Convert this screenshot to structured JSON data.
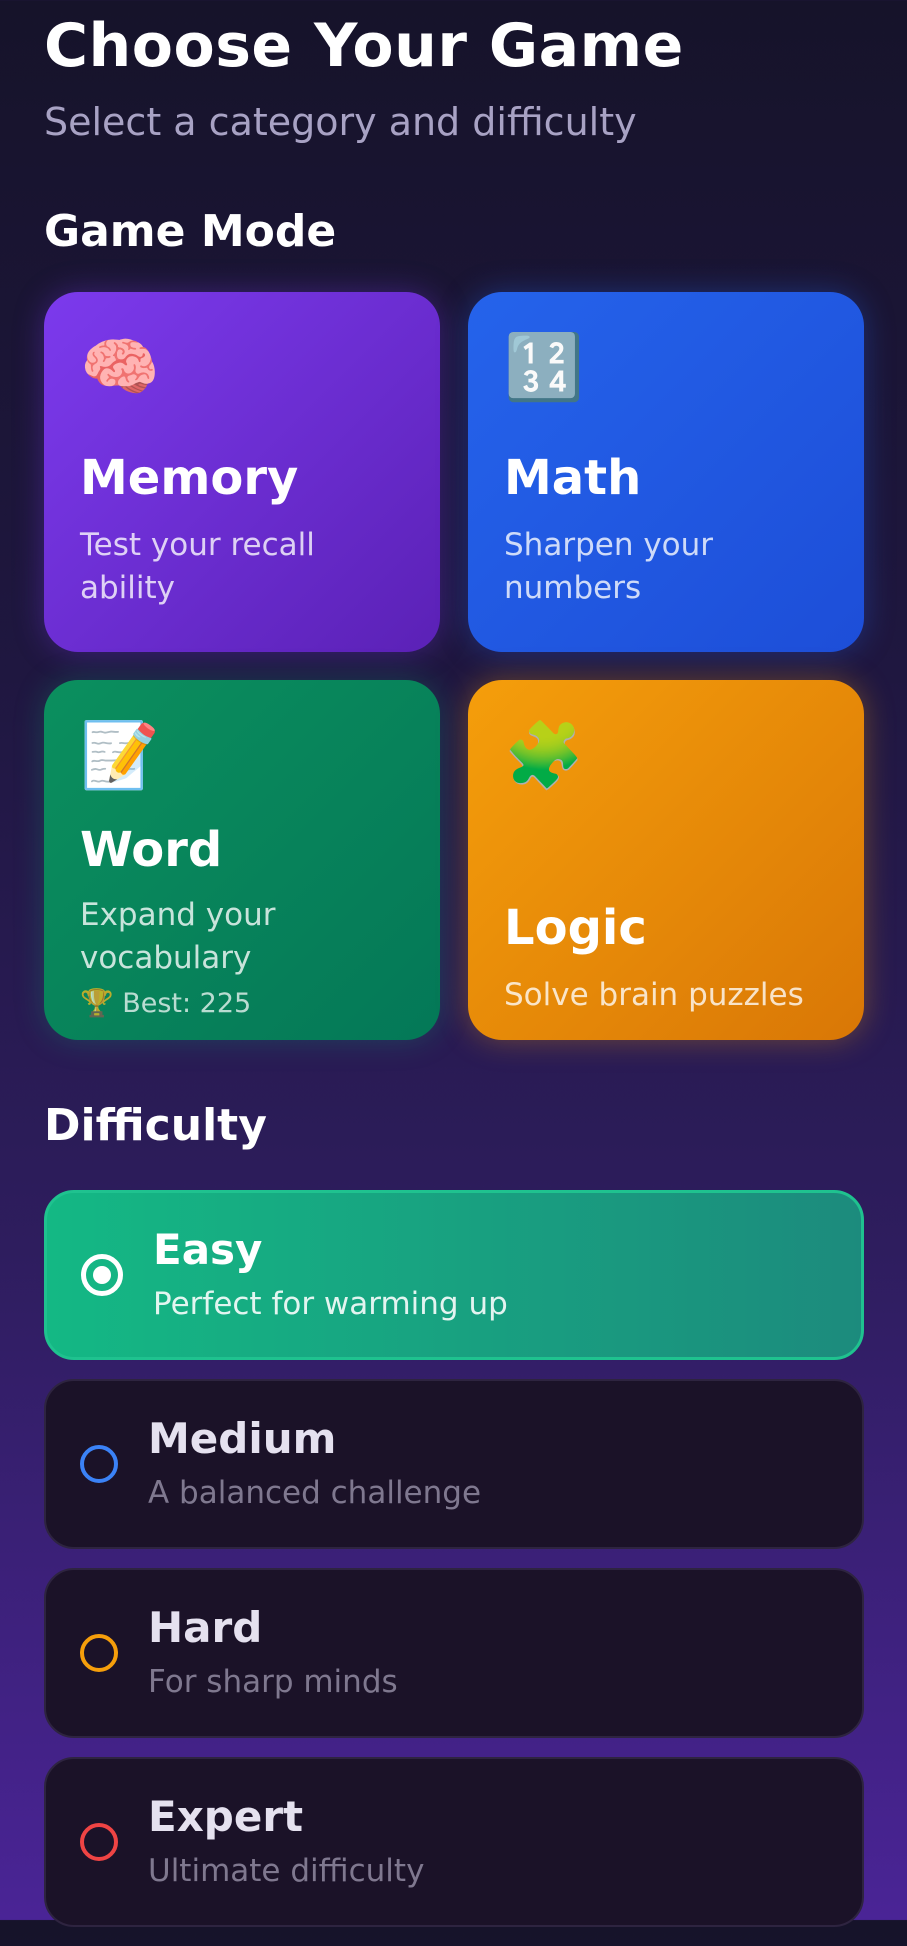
{
  "header": {
    "title": "Choose Your Game",
    "subtitle": "Select a category and difficulty"
  },
  "game_mode": {
    "heading": "Game Mode",
    "cards": [
      {
        "name": "Memory",
        "description": "Test your recall ability",
        "icon": "🧠",
        "icon_name": "brain-icon",
        "color": "#7c3aed"
      },
      {
        "name": "Math",
        "description": "Sharpen your numbers",
        "icon": "🔢",
        "icon_name": "numbers-icon",
        "color": "#2563eb"
      },
      {
        "name": "Word",
        "description": "Expand your vocabulary",
        "icon": "📝",
        "icon_name": "memo-icon",
        "best": "🏆 Best: 225",
        "color": "#047857"
      },
      {
        "name": "Logic",
        "description": "Solve brain puzzles",
        "icon": "🧩",
        "icon_name": "puzzle-icon",
        "color": "#f59e0b"
      }
    ]
  },
  "difficulty": {
    "heading": "Difficulty",
    "options": [
      {
        "name": "Easy",
        "description": "Perfect for warming up",
        "selected": true,
        "color": "#10b981"
      },
      {
        "name": "Medium",
        "description": "A balanced challenge",
        "selected": false,
        "color": "#3b82f6"
      },
      {
        "name": "Hard",
        "description": "For sharp minds",
        "selected": false,
        "color": "#f59e0b"
      },
      {
        "name": "Expert",
        "description": "Ultimate difficulty",
        "selected": false,
        "color": "#ef4444"
      }
    ]
  }
}
